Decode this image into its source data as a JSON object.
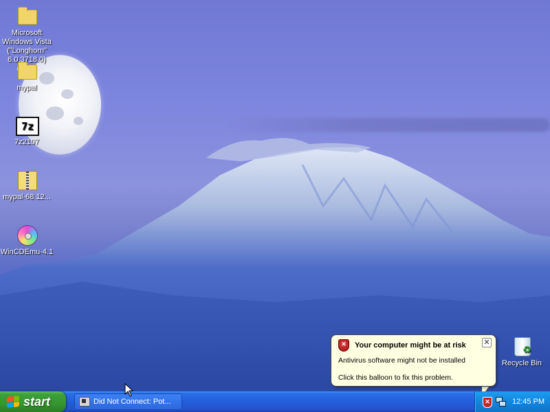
{
  "desktop": {
    "icons": [
      {
        "label": "Microsoft Windows Vista (\"Longhorn\" 6.0.3718.0) (beta)",
        "type": "folder"
      },
      {
        "label": "mypal",
        "type": "folder"
      },
      {
        "label": "7z2107",
        "type": "7z-installer"
      },
      {
        "label": "mypal-68.12...",
        "type": "zip-archive"
      },
      {
        "label": "WinCDEmu-4.1",
        "type": "disc"
      },
      {
        "label": "Recycle Bin",
        "type": "recycle-bin"
      }
    ]
  },
  "taskbar": {
    "start_label": "start",
    "window_button": "Did Not Connect: Pot...",
    "clock": "12:45 PM"
  },
  "balloon": {
    "title": "Your computer might be at risk",
    "line1": "Antivirus software might not be installed",
    "line2": "Click this balloon to fix this problem.",
    "close_symbol": "✕"
  },
  "colors": {
    "taskbar_blue": "#245edc",
    "start_green": "#36962f",
    "tray_blue": "#1386de",
    "balloon_bg": "#ffffe1"
  }
}
